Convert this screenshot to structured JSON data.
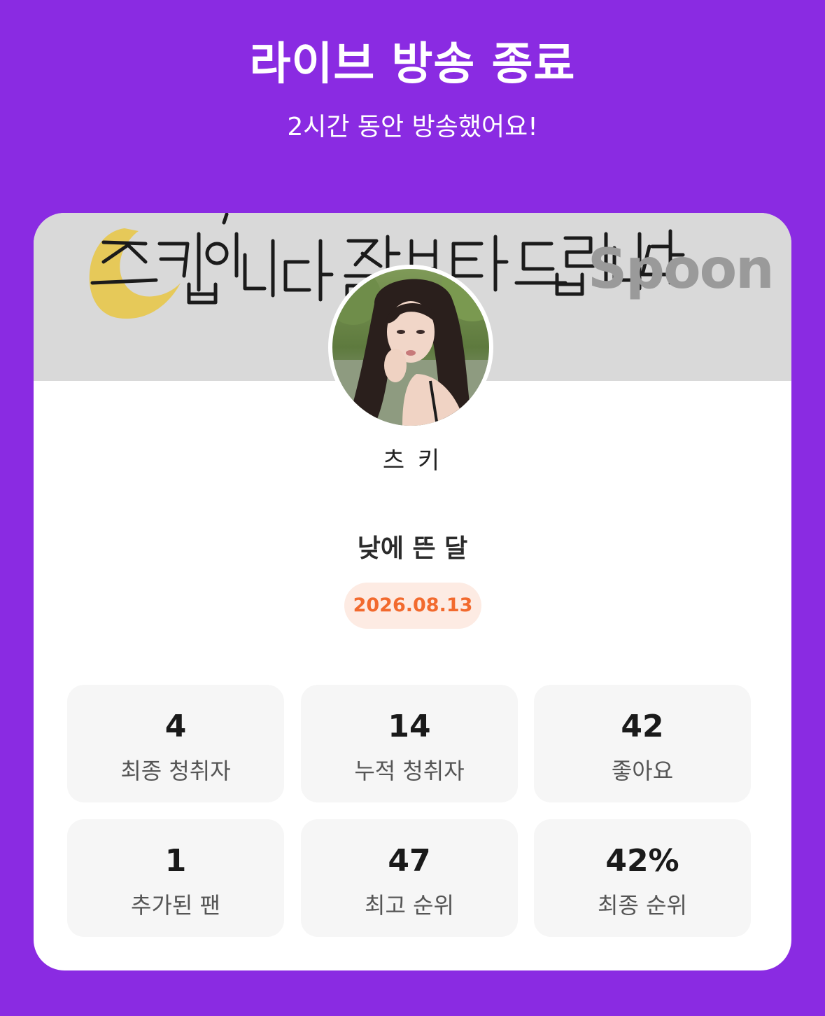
{
  "header": {
    "title": "라이브 방송 종료",
    "subtitle": "2시간 동안 방송했어요!"
  },
  "banner": {
    "handwriting": "츠키입니다 잘부탁드립니다",
    "brand": "Spoon"
  },
  "host": {
    "name": "츠 키",
    "avatar": "profile-photo"
  },
  "live": {
    "title": "낮에 뜬 달",
    "date": "2026.08.13"
  },
  "stats": [
    {
      "value": "4",
      "label": "최종 청취자"
    },
    {
      "value": "14",
      "label": "누적 청취자"
    },
    {
      "value": "42",
      "label": "좋아요"
    },
    {
      "value": "1",
      "label": "추가된 팬"
    },
    {
      "value": "47",
      "label": "최고 순위"
    },
    {
      "value": "42%",
      "label": "최종 순위"
    }
  ],
  "colors": {
    "background": "#8a2be2",
    "date_text": "#f26a2e",
    "date_bg": "#fdebe3"
  }
}
